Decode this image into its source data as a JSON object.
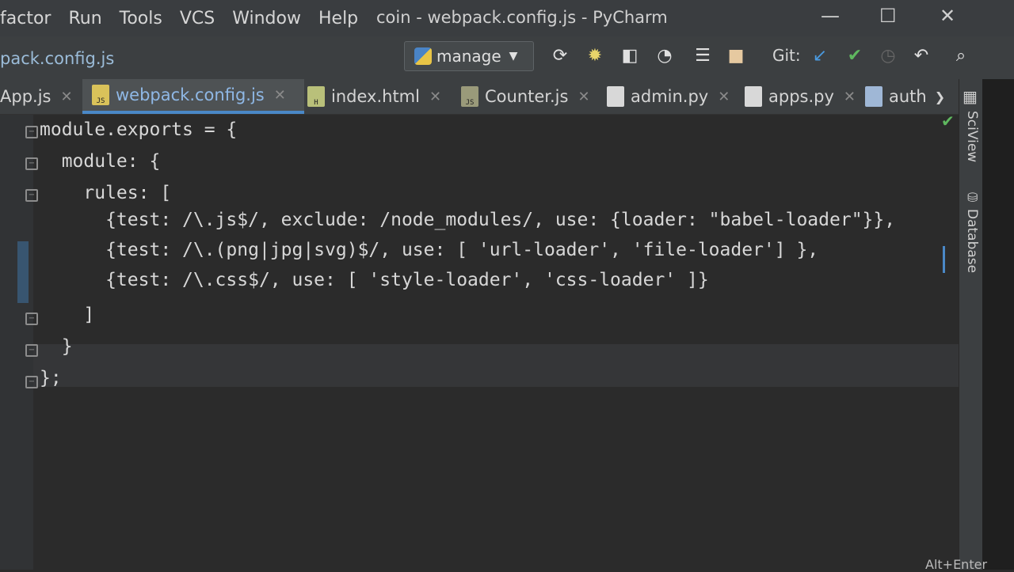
{
  "menu": {
    "items": [
      "factor",
      "Run",
      "Tools",
      "VCS",
      "Window",
      "Help"
    ]
  },
  "window": {
    "title": "coin - webpack.config.js - PyCharm",
    "minimize": "—",
    "maximize": "☐",
    "close": "✕"
  },
  "navbar": {
    "breadcrumb": "pack.config.js",
    "run_config": "manage",
    "git_label": "Git:",
    "icons": [
      "rerun-icon",
      "debug-icon",
      "coverage-icon",
      "profile-icon",
      "run-concurrency-icon",
      "stop-icon",
      "vcs-update-icon",
      "vcs-commit-icon",
      "vcs-history-icon",
      "undo-icon",
      "search-icon"
    ]
  },
  "tabs": [
    {
      "label": "App.js",
      "icon": "js-file-icon",
      "active": false
    },
    {
      "label": "webpack.config.js",
      "icon": "js-file-icon",
      "active": true
    },
    {
      "label": "index.html",
      "icon": "html-file-icon",
      "active": false
    },
    {
      "label": "Counter.js",
      "icon": "js-file-icon",
      "active": false
    },
    {
      "label": "admin.py",
      "icon": "python-file-icon",
      "active": false
    },
    {
      "label": "apps.py",
      "icon": "python-file-icon",
      "active": false
    },
    {
      "label": "auth",
      "icon": "python-file-icon",
      "active": false
    }
  ],
  "tool_windows": {
    "sciview": "SciView",
    "database": "Database"
  },
  "code": {
    "lines": [
      "module.exports = {",
      "  module: {",
      "    rules: [",
      "      {test: /\\.js$/, exclude: /node_modules/, use: {loader: \"babel-loader\"}},",
      "      {test: /\\.(png|jpg|svg)$/, use: [ 'url-loader', 'file-loader'] },",
      "      {test: /\\.css$/, use: [ 'style-loader', 'css-loader' ]}",
      "    ]",
      "  }",
      "};"
    ]
  },
  "status_hint": "Alt+Enter",
  "colors": {
    "accent": "#4a88c7",
    "string": "#a9c38d",
    "ok": "#5fb85f"
  }
}
